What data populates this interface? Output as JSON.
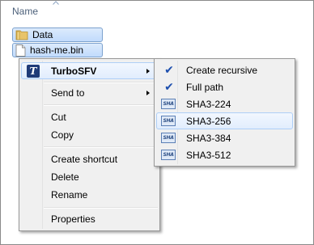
{
  "explorer": {
    "column_header": "Name",
    "items": [
      {
        "label": "Data",
        "icon": "folder-icon"
      },
      {
        "label": "hash-me.bin",
        "icon": "file-icon"
      }
    ]
  },
  "context_menu": {
    "items": [
      {
        "label": "TurboSFV",
        "icon": "turbosfv-icon",
        "icon_glyph": "T",
        "has_submenu": true
      },
      {
        "label": "Send to",
        "has_submenu": true
      },
      {
        "label": "Cut"
      },
      {
        "label": "Copy"
      },
      {
        "label": "Create shortcut"
      },
      {
        "label": "Delete"
      },
      {
        "label": "Rename"
      },
      {
        "label": "Properties"
      }
    ]
  },
  "submenu": {
    "items": [
      {
        "label": "Create recursive",
        "icon": "check-icon",
        "checked": true
      },
      {
        "label": "Full path",
        "icon": "check-icon",
        "checked": true
      },
      {
        "label": "SHA3-224",
        "icon": "sha-icon",
        "icon_text": "SHA"
      },
      {
        "label": "SHA3-256",
        "icon": "sha-icon",
        "icon_text": "SHA",
        "highlighted": true
      },
      {
        "label": "SHA3-384",
        "icon": "sha-icon",
        "icon_text": "SHA"
      },
      {
        "label": "SHA3-512",
        "icon": "sha-icon",
        "icon_text": "SHA"
      }
    ]
  },
  "colors": {
    "header_text": "#4c607a",
    "selection_border": "#7da2ce",
    "highlight_border": "#aecff7",
    "menu_background": "#f0f0f0"
  }
}
